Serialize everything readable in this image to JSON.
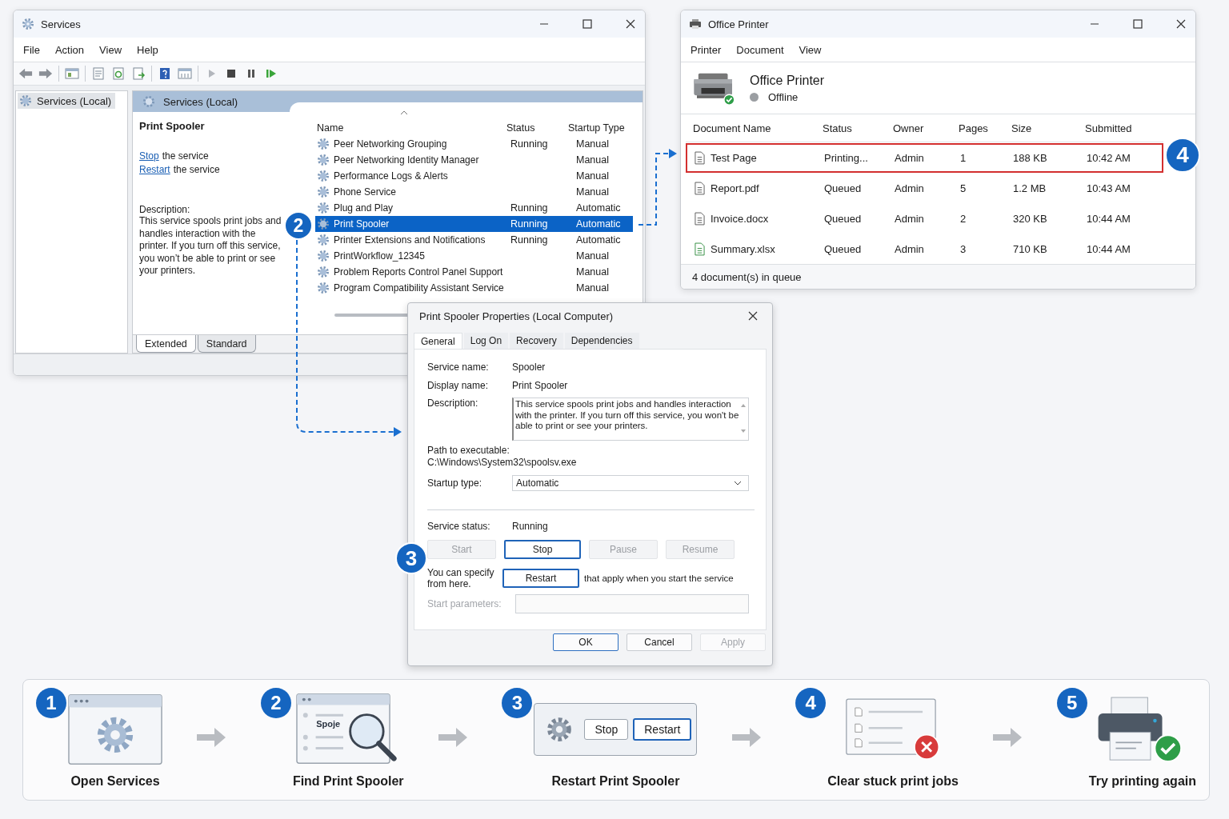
{
  "services_window": {
    "title": "Services",
    "menu": [
      "File",
      "Action",
      "View",
      "Help"
    ],
    "tree": [
      {
        "label": "Services (Local)",
        "selected": true
      }
    ],
    "pane_title": "Services (Local)",
    "detail": {
      "service": "Print Spooler",
      "actions": [
        {
          "link": "Stop",
          "text": "the service"
        },
        {
          "link": "Restart",
          "text": "the service"
        }
      ],
      "description_label": "Description:",
      "description": "This service spools print jobs and handles interaction with the printer. If you turn off this service, you won’t be able to print or see your printers."
    },
    "columns": [
      "Name",
      "Status",
      "Startup Type"
    ],
    "rows": [
      {
        "name": "Peer Networking Grouping",
        "status": "Running",
        "startup": "Manual",
        "selected": false
      },
      {
        "name": "Peer Networking Identity Manager",
        "startup": "Manual",
        "selected": false
      },
      {
        "name": "Performance Logs & Alerts",
        "startup": "Manual",
        "selected": false
      },
      {
        "name": "Phone Service",
        "startup": "Manual",
        "selected": false
      },
      {
        "name": "Plug and Play",
        "status": "Running",
        "startup": "Automatic",
        "selected": false
      },
      {
        "name": "Print Spooler",
        "status": "Running",
        "startup": "Automatic",
        "selected": true
      },
      {
        "name": "Printer Extensions and Notifications",
        "status": "Running",
        "startup": "Automatic",
        "selected": false
      },
      {
        "name": "PrintWorkflow_12345",
        "startup": "Manual",
        "selected": false
      },
      {
        "name": "Problem Reports Control Panel Support",
        "startup": "Manual",
        "selected": false
      },
      {
        "name": "Program Compatibility Assistant Service",
        "startup": "Manual",
        "selected": false
      }
    ],
    "tabs": [
      {
        "label": "Extended",
        "selected": true
      },
      {
        "label": "Standard",
        "selected": false
      }
    ],
    "callout": "2"
  },
  "printer_window": {
    "title": "Office Printer",
    "menu": [
      "Printer",
      "Document",
      "View"
    ],
    "printer_name": "Office Printer",
    "online": false,
    "status": "Offline",
    "columns": [
      "Document Name",
      "Status",
      "Owner",
      "Pages",
      "Size",
      "Submitted"
    ],
    "jobs": [
      {
        "kind": "doc",
        "name": "Test Page",
        "status": "Printing...",
        "owner": "Admin",
        "pages": "1",
        "size": "188 KB",
        "submitted": "10:42 AM",
        "highlighted": true
      },
      {
        "kind": "doc",
        "name": "Report.pdf",
        "status": "Queued",
        "owner": "Admin",
        "pages": "5",
        "size": "1.2 MB",
        "submitted": "10:43 AM",
        "highlighted": false
      },
      {
        "kind": "doc",
        "name": "Invoice.docx",
        "status": "Queued",
        "owner": "Admin",
        "pages": "2",
        "size": "320 KB",
        "submitted": "10:44 AM",
        "highlighted": false
      },
      {
        "kind": "sheet",
        "name": "Summary.xlsx",
        "status": "Queued",
        "owner": "Admin",
        "pages": "3",
        "size": "710 KB",
        "submitted": "10:44 AM",
        "highlighted": false
      }
    ],
    "status_bar": "4 document(s) in queue",
    "callout": "4"
  },
  "properties_dialog": {
    "title": "Print Spooler Properties (Local Computer)",
    "tabs": [
      {
        "label": "General",
        "selected": true
      },
      {
        "label": "Log On",
        "selected": false
      },
      {
        "label": "Recovery",
        "selected": false
      },
      {
        "label": "Dependencies",
        "selected": false
      }
    ],
    "fields": [
      {
        "label": "Service name:",
        "value": "Spooler"
      },
      {
        "label": "Display name:",
        "value": "Print Spooler"
      }
    ],
    "description_label": "Description:",
    "description": "This service spools print jobs and handles interaction with the printer. If you turn off this service, you won't be able to print or see your printers.",
    "path_label": "Path to executable:",
    "path": "C:\\Windows\\System32\\spoolsv.exe",
    "startup_label": "Startup type:",
    "startup_value": "Automatic",
    "status_label": "Service status:",
    "status_value": "Running",
    "service_buttons": [
      {
        "label": "Start",
        "disabled": true,
        "highlighted": false
      },
      {
        "label": "Stop",
        "disabled": false,
        "highlighted": true
      },
      {
        "label": "Pause",
        "disabled": true,
        "highlighted": false
      },
      {
        "label": "Resume",
        "disabled": true,
        "highlighted": false
      }
    ],
    "hint_start": "You can specify from here.",
    "restart_button": {
      "label": "Restart",
      "highlighted": true
    },
    "hint_end": "that apply when you start the service",
    "params_label": "Start parameters:",
    "params_disabled": true,
    "footer_buttons": [
      {
        "label": "OK",
        "disabled": false,
        "highlighted": true
      },
      {
        "label": "Cancel",
        "disabled": false,
        "highlighted": false
      },
      {
        "label": "Apply",
        "disabled": true,
        "highlighted": false
      }
    ],
    "callout": "3"
  },
  "steps": [
    {
      "kind": "window",
      "number": "1",
      "label": "Open Services"
    },
    {
      "kind": "search",
      "number": "2",
      "label": "Find Print Spooler",
      "icon_text": "Spoje"
    },
    {
      "kind": "buttons",
      "number": "3",
      "label": "Restart Print Spooler",
      "buttons": [
        "Stop",
        "Restart"
      ]
    },
    {
      "kind": "queue",
      "number": "4",
      "label": "Clear stuck print jobs"
    },
    {
      "kind": "printer",
      "number": "5",
      "label": "Try printing again"
    }
  ]
}
